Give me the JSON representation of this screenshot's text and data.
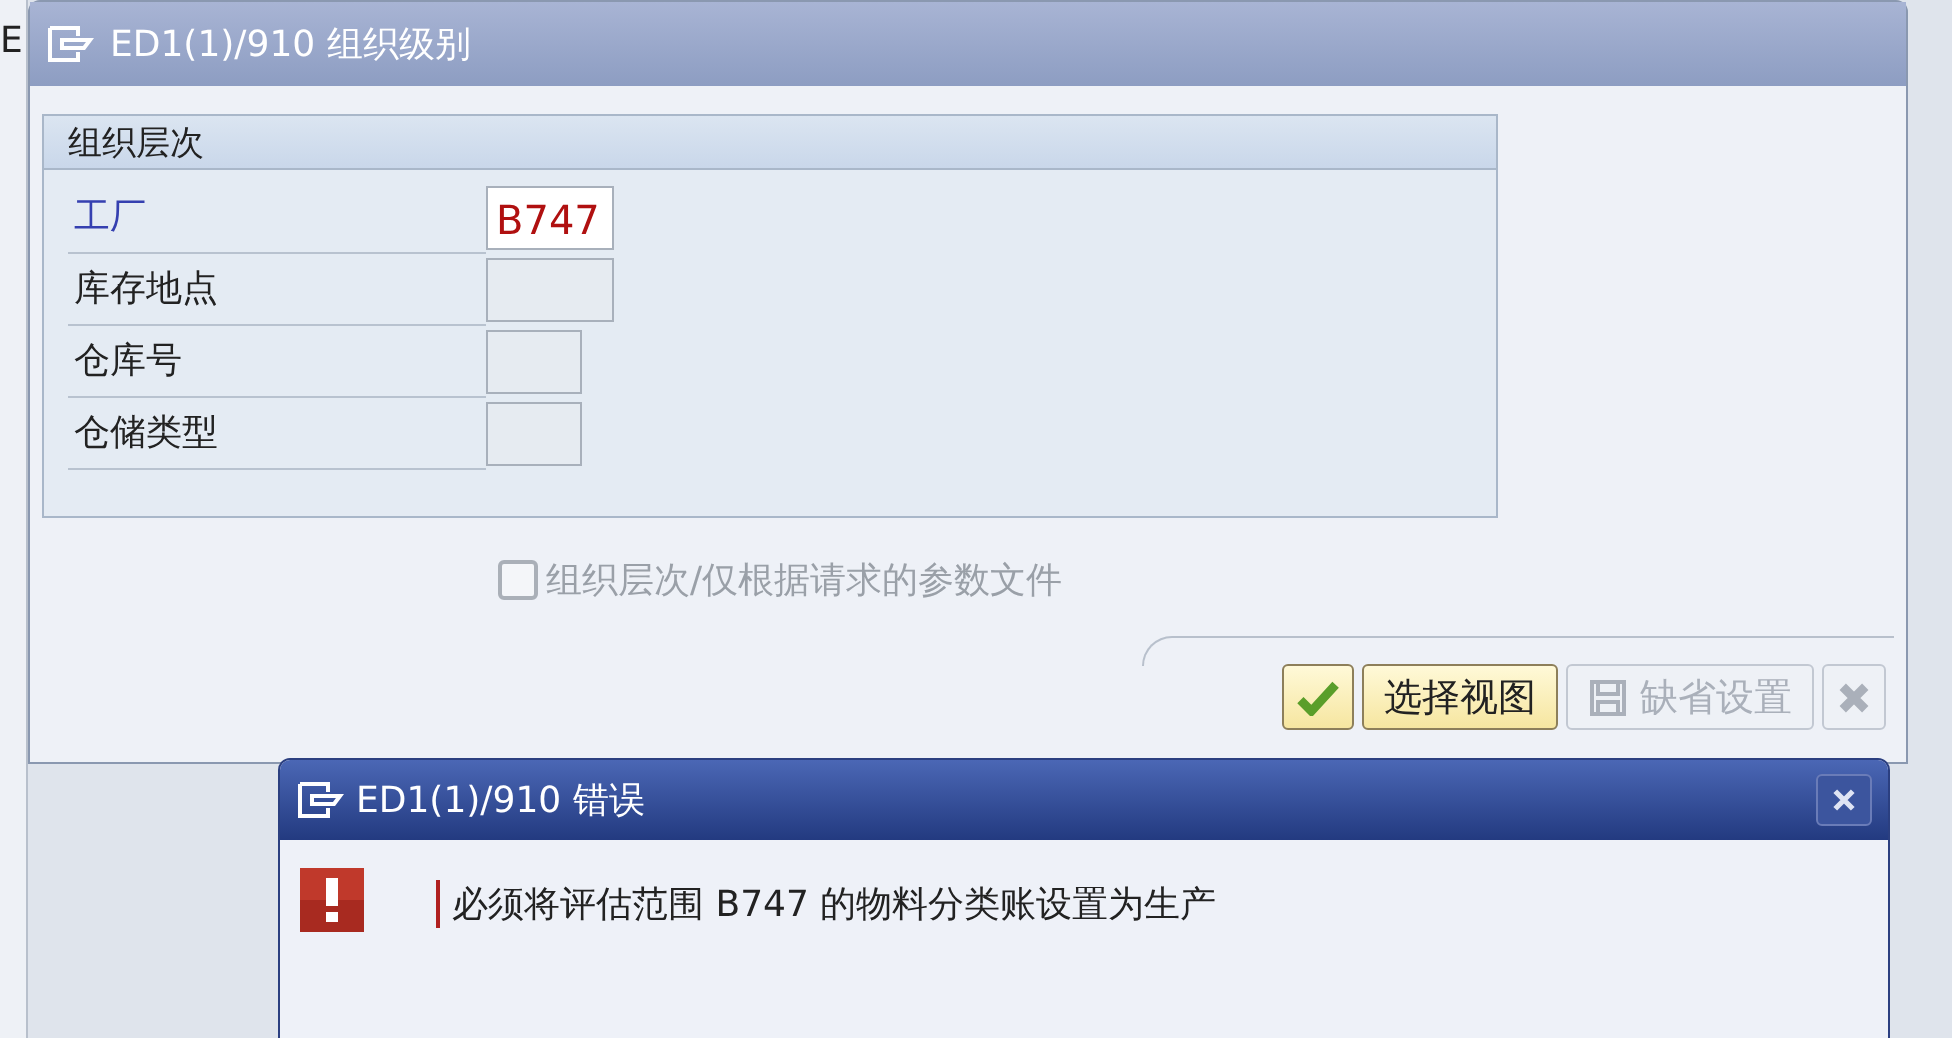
{
  "background_window": {
    "title_fragment": "E"
  },
  "window": {
    "title": "ED1(1)/910 组织级别"
  },
  "group": {
    "title": "组织层次",
    "fields": [
      {
        "label": "工厂",
        "value": "B747",
        "required": true
      },
      {
        "label": "库存地点",
        "required": false
      },
      {
        "label": "仓库号",
        "required": false
      },
      {
        "label": "仓储类型",
        "required": false
      }
    ]
  },
  "checkbox": {
    "label": "组织层次/仅根据请求的参数文件",
    "checked": false,
    "disabled": true
  },
  "buttons": [
    {
      "kind": "confirm",
      "disabled": false
    },
    {
      "kind": "text",
      "label": "选择视图",
      "disabled": false
    },
    {
      "kind": "save",
      "label": "缺省设置",
      "disabled": true
    },
    {
      "kind": "cancel",
      "disabled": true
    }
  ],
  "error_dialog": {
    "title": "ED1(1)/910 错误",
    "message": "必须将评估范围 B747 的物料分类账设置为生产"
  }
}
